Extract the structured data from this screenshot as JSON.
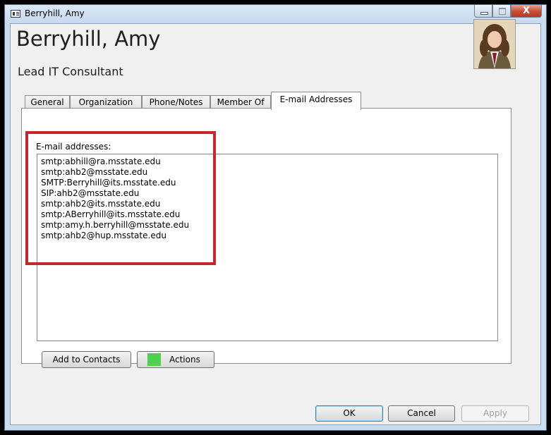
{
  "window": {
    "title": "Berryhill, Amy",
    "close_glyph": "X"
  },
  "header": {
    "name": "Berryhill, Amy",
    "job_title": "Lead IT Consultant",
    "photo_icon": "person-photo"
  },
  "tabs": [
    {
      "label": "General",
      "active": false
    },
    {
      "label": "Organization",
      "active": false
    },
    {
      "label": "Phone/Notes",
      "active": false
    },
    {
      "label": "Member Of",
      "active": false
    },
    {
      "label": "E-mail Addresses",
      "active": true
    }
  ],
  "email_panel": {
    "label": "E-mail addresses:",
    "addresses": [
      "smtp:abhill@ra.msstate.edu",
      "smtp:ahb2@msstate.edu",
      "SMTP:Berryhill@its.msstate.edu",
      "SIP:ahb2@msstate.edu",
      "smtp:ahb2@its.msstate.edu",
      "smtp:ABerryhill@its.msstate.edu",
      "smtp:amy.h.berryhill@msstate.edu",
      "smtp:ahb2@hup.msstate.edu"
    ],
    "highlight_color": "#c1272d"
  },
  "panel_buttons": {
    "add_to_contacts": "Add to Contacts",
    "actions": "Actions",
    "actions_swatch_color": "#4fd04f"
  },
  "dialog_buttons": {
    "ok": "OK",
    "cancel": "Cancel",
    "apply": "Apply"
  }
}
